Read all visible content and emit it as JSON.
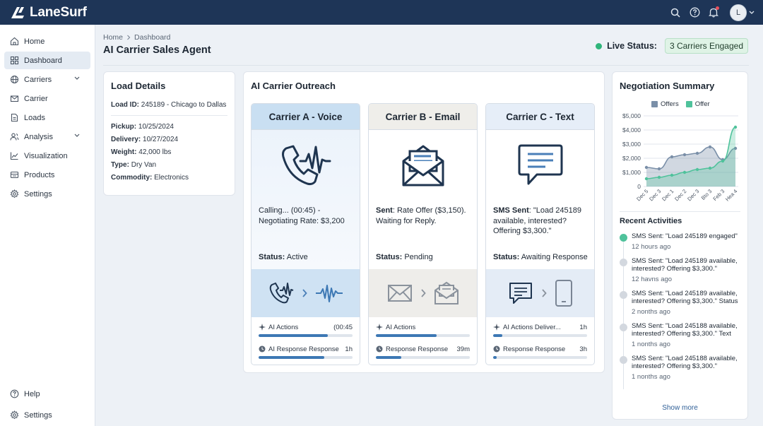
{
  "app": {
    "name": "LaneSurf",
    "user_initial": "L"
  },
  "nav": {
    "items": [
      {
        "label": "Home",
        "icon": "home-icon"
      },
      {
        "label": "Dashboard",
        "icon": "grid-icon",
        "active": true
      },
      {
        "label": "Carriers",
        "icon": "globe-icon",
        "expandable": true
      },
      {
        "label": "Carrier",
        "icon": "mail-icon"
      },
      {
        "label": "Loads",
        "icon": "document-icon"
      },
      {
        "label": "Analysis",
        "icon": "users-icon",
        "expandable": true
      },
      {
        "label": "Visualization",
        "icon": "line-chart-icon"
      },
      {
        "label": "Products",
        "icon": "package-icon"
      },
      {
        "label": "Settings",
        "icon": "gear-icon"
      }
    ],
    "bottom": [
      {
        "label": "Help",
        "icon": "help-icon"
      },
      {
        "label": "Settings",
        "icon": "gear-icon"
      }
    ]
  },
  "header": {
    "breadcrumb": [
      "Home",
      "Dashboard"
    ],
    "title": "AI Carrier Sales Agent",
    "live_label": "Live Status:",
    "live_value": "3 Carriers Engaged"
  },
  "load": {
    "title": "Load Details",
    "id_label": "Load ID:",
    "id_value": "245189 - Chicago to Dallas",
    "fields": [
      {
        "label": "Pickup:",
        "value": "10/25/2024"
      },
      {
        "label": "Delivery:",
        "value": "10/27/2024"
      },
      {
        "label": "Weight:",
        "value": "42,000 lbs"
      },
      {
        "label": "Type:",
        "value": "Dry Van"
      },
      {
        "label": "Commodity:",
        "value": "Electronics"
      }
    ]
  },
  "outreach": {
    "title": "AI Carrier Outreach",
    "carriers": [
      {
        "name": "Carrier A - Voice",
        "icon": "phone-waveform-icon",
        "msg_label": "",
        "msg": "Calling... (00:45) - Negotiating Rate: $3,200",
        "status_label": "Status:",
        "status": "Active",
        "flow_from": "phone-icon",
        "flow_to": "waveform-icon",
        "actions_label": "AI Actions",
        "actions_time": "(00:45",
        "actions_progress": 0.74,
        "response_label": "AI Response Response",
        "response_time": "1h",
        "response_progress": 0.7
      },
      {
        "name": "Carrier B - Email",
        "icon": "open-envelope-icon",
        "msg_label": "Sent",
        "msg": ": Rate Offer ($3,150). Waiting for Reply.",
        "status_label": "Status:",
        "status": "Pending",
        "flow_from": "envelope-icon",
        "flow_to": "open-envelope-icon",
        "actions_label": "AI Actions",
        "actions_time": "",
        "actions_progress": 0.65,
        "response_label": "Response Response",
        "response_time": "39m",
        "response_progress": 0.27
      },
      {
        "name": "Carrier C - Text",
        "icon": "chat-bubble-icon",
        "msg_label": "SMS Sent",
        "msg": ": \"Load 245189 available, interested? Offering $3,300.\"",
        "status_label": "Status:",
        "status": "Awaiting Response",
        "flow_from": "chat-bubble-icon",
        "flow_to": "mobile-phone-icon",
        "actions_label": "AI Actions Deliver...",
        "actions_time": "1h",
        "actions_progress": 0.1,
        "response_label": "Response Response",
        "response_time": "3h",
        "response_progress": 0.04
      }
    ]
  },
  "negotiation": {
    "title": "Negotiation Summary",
    "recent_title": "Recent Activities",
    "show_more": "Show more",
    "activities": [
      {
        "text": "SMS Sent: \"Load 245189 engaged\"",
        "time": "12 hours ago"
      },
      {
        "text": "SMS Sent: \"Load 245189 available, interested? Offering $3,300.\"",
        "time": "12 havns ago"
      },
      {
        "text": "SMS Sent: \"Load 245189 available, interested? Offering $3,300.\" Status",
        "time": "2 nonths ago"
      },
      {
        "text": "SMS Sent: \"Load 245188 available, interested? Offering $3,300.\" Text",
        "time": "1 nonths ago"
      },
      {
        "text": "SMS Sent: \"Load 245188 available, interested? Offering $3,300.\"",
        "time": "1 nonths ago"
      }
    ]
  },
  "chart_data": {
    "type": "area",
    "title": "",
    "x": [
      "Dec 5",
      "Dec 3",
      "Dec 1",
      "Dec 2",
      "Dec 3",
      "Bto 3",
      "Feb 3",
      "Hea 4"
    ],
    "series": [
      {
        "name": "Offers",
        "color": "#7a8fa8",
        "values": [
          1350,
          1250,
          2100,
          2250,
          2350,
          2800,
          1900,
          2700
        ]
      },
      {
        "name": "Offer",
        "color": "#4fc29b",
        "values": [
          550,
          650,
          800,
          1000,
          1200,
          1300,
          1800,
          4200
        ]
      }
    ],
    "yticks": [
      "$5,000",
      "$4,000",
      "$3,000",
      "$2,000",
      "$1,000",
      "0"
    ],
    "ylim": [
      0,
      5000
    ],
    "grid": true,
    "legend": "top"
  }
}
